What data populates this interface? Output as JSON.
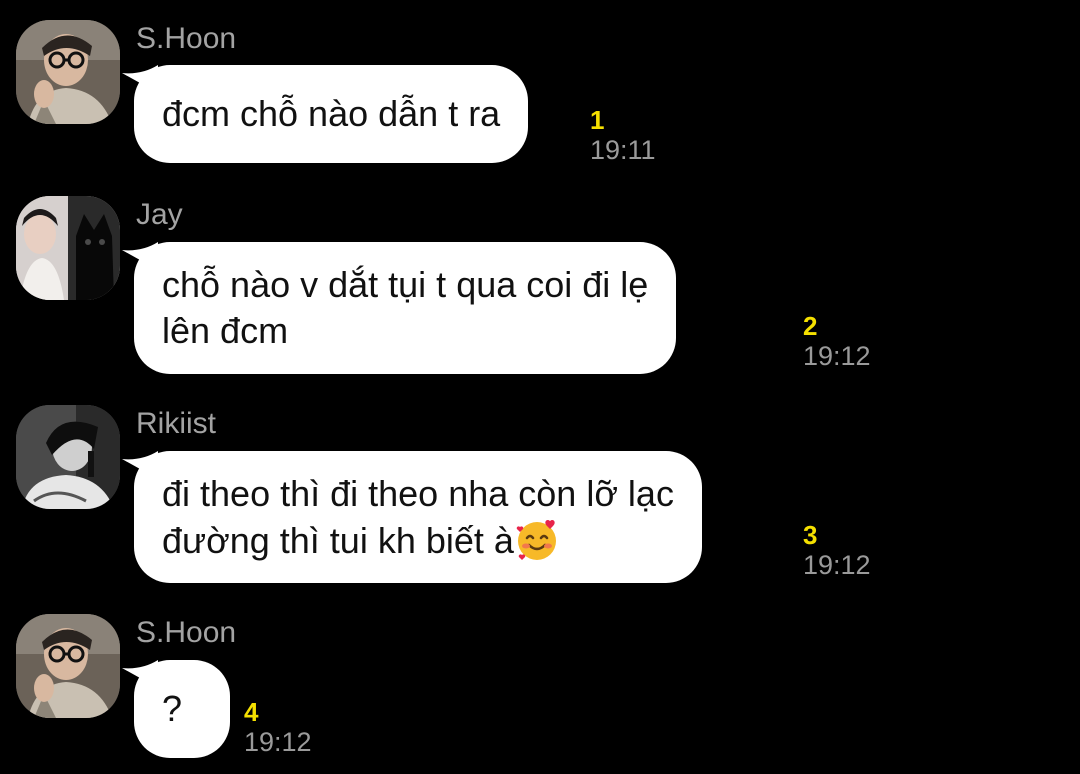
{
  "messages": [
    {
      "sender": "S.Hoon",
      "text": "đcm chỗ nào dẫn t ra",
      "unread": "1",
      "time": "19:11",
      "avatar": "user-photo-glasses"
    },
    {
      "sender": "Jay",
      "text": "chỗ nào v dắt tụi t qua coi đi lẹ\nlên đcm",
      "unread": "2",
      "time": "19:12",
      "avatar": "user-photo-cat"
    },
    {
      "sender": "Rikiist",
      "text": "đi theo thì đi theo nha còn lỡ lạc\nđường thì tui kh biết à",
      "emoji": "smiling-face-with-hearts",
      "unread": "3",
      "time": "19:12",
      "avatar": "user-photo-monochrome"
    },
    {
      "sender": "S.Hoon",
      "text": "?",
      "unread": "4",
      "time": "19:12",
      "avatar": "user-photo-glasses"
    }
  ],
  "colors": {
    "background": "#000000",
    "bubble": "#ffffff",
    "unread": "#f5e000",
    "time": "#9a9a9a",
    "sender": "#a3a3a3"
  }
}
